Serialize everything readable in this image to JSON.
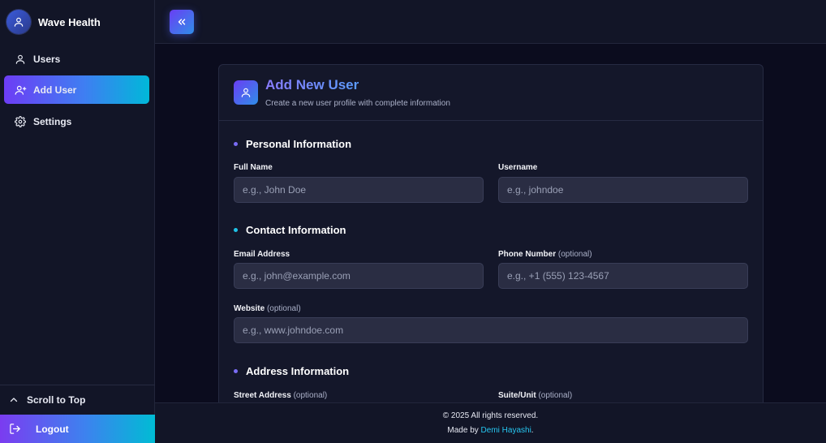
{
  "brand": {
    "name": "Wave Health",
    "icon": "user-icon"
  },
  "sidebar": {
    "items": [
      {
        "label": "Users",
        "icon": "user-icon"
      },
      {
        "label": "Add User",
        "icon": "user-plus-icon",
        "active": true
      },
      {
        "label": "Settings",
        "icon": "gear-icon"
      }
    ],
    "scroll_top": "Scroll to Top",
    "logout": "Logout"
  },
  "topbar": {
    "collapse_icon": "chevrons-left-icon"
  },
  "card": {
    "title": "Add New User",
    "subtitle": "Create a new user profile with complete information"
  },
  "sections": {
    "personal": {
      "title": "Personal Information"
    },
    "contact": {
      "title": "Contact Information"
    },
    "address": {
      "title": "Address Information"
    }
  },
  "fields": {
    "full_name": {
      "label": "Full Name",
      "placeholder": "e.g., John Doe"
    },
    "username": {
      "label": "Username",
      "placeholder": "e.g., johndoe"
    },
    "email": {
      "label": "Email Address",
      "placeholder": "e.g., john@example.com"
    },
    "phone": {
      "label": "Phone Number",
      "optional": "(optional)",
      "placeholder": "e.g., +1 (555) 123-4567"
    },
    "website": {
      "label": "Website",
      "optional": "(optional)",
      "placeholder": "e.g., www.johndoe.com"
    },
    "street": {
      "label": "Street Address",
      "optional": "(optional)"
    },
    "suite": {
      "label": "Suite/Unit",
      "optional": "(optional)"
    }
  },
  "footer": {
    "copyright": "© 2025 All rights reserved.",
    "made_by_prefix": "Made by ",
    "author": "Demi Hayashi",
    "suffix": "."
  },
  "colors": {
    "accent_start": "#6d3df5",
    "accent_end": "#00b8d9",
    "background": "#0b0c1e",
    "panel": "#121527",
    "link": "#26c6f0"
  }
}
